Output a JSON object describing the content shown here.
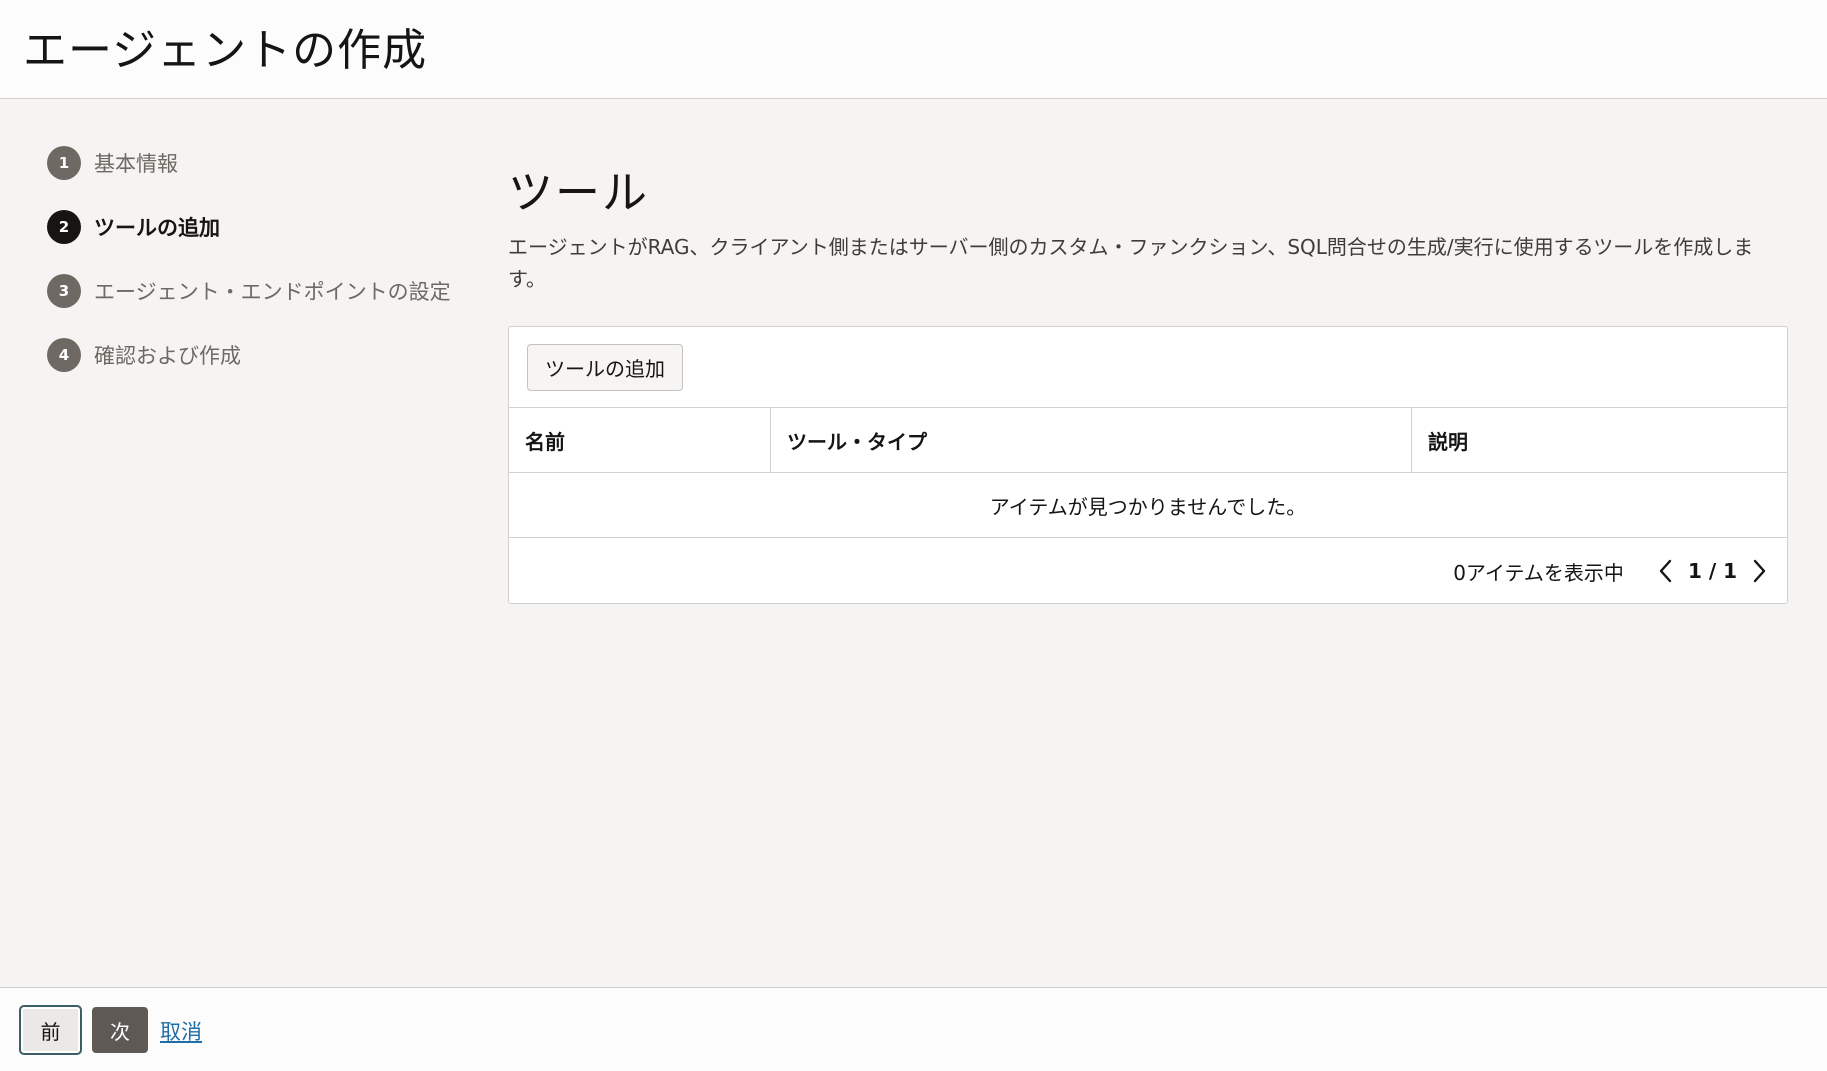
{
  "header": {
    "title": "エージェントの作成"
  },
  "steps": [
    {
      "number": "1",
      "label": "基本情報",
      "active": false
    },
    {
      "number": "2",
      "label": "ツールの追加",
      "active": true
    },
    {
      "number": "3",
      "label": "エージェント・エンドポイントの設定",
      "active": false
    },
    {
      "number": "4",
      "label": "確認および作成",
      "active": false
    }
  ],
  "main": {
    "title": "ツール",
    "description": "エージェントがRAG、クライアント側またはサーバー側のカスタム・ファンクション、SQL問合せの生成/実行に使用するツールを作成します。"
  },
  "table": {
    "add_button_label": "ツールの追加",
    "columns": [
      "名前",
      "ツール・タイプ",
      "説明"
    ],
    "empty_message": "アイテムが見つかりませんでした。",
    "item_count": "0アイテムを表示中",
    "pages": "1 / 1"
  },
  "footer": {
    "prev_label": "前",
    "next_label": "次",
    "cancel_label": "取消"
  },
  "colors": {
    "active_step": "#161513",
    "inactive_step": "#6f6964",
    "link": "#1f6ea8",
    "primary_button": "#5f5955"
  }
}
